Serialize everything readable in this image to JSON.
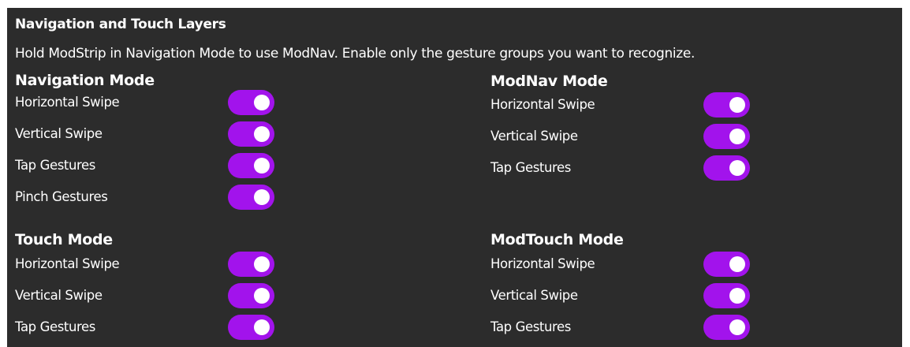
{
  "header": {
    "title": "Navigation and Touch Layers",
    "description": "Hold ModStrip in Navigation Mode to use ModNav. Enable only the gesture groups you want to recognize."
  },
  "sections": {
    "navigation": {
      "title": "Navigation Mode",
      "items": [
        {
          "label": "Horizontal Swipe",
          "enabled": true
        },
        {
          "label": "Vertical Swipe",
          "enabled": true
        },
        {
          "label": "Tap Gestures",
          "enabled": true
        },
        {
          "label": "Pinch Gestures",
          "enabled": true
        }
      ]
    },
    "modnav": {
      "title": "ModNav Mode",
      "items": [
        {
          "label": "Horizontal Swipe",
          "enabled": true
        },
        {
          "label": "Vertical Swipe",
          "enabled": true
        },
        {
          "label": "Tap Gestures",
          "enabled": true
        }
      ]
    },
    "touch": {
      "title": "Touch Mode",
      "items": [
        {
          "label": "Horizontal Swipe",
          "enabled": true
        },
        {
          "label": "Vertical Swipe",
          "enabled": true
        },
        {
          "label": "Tap Gestures",
          "enabled": true
        }
      ]
    },
    "modtouch": {
      "title": "ModTouch Mode",
      "items": [
        {
          "label": "Horizontal Swipe",
          "enabled": true
        },
        {
          "label": "Vertical Swipe",
          "enabled": true
        },
        {
          "label": "Tap Gestures",
          "enabled": true
        }
      ]
    }
  },
  "colors": {
    "panel_background": "#2c2c2c",
    "toggle_on": "#a213ec",
    "knob": "#ffffff",
    "text": "#ffffff"
  }
}
